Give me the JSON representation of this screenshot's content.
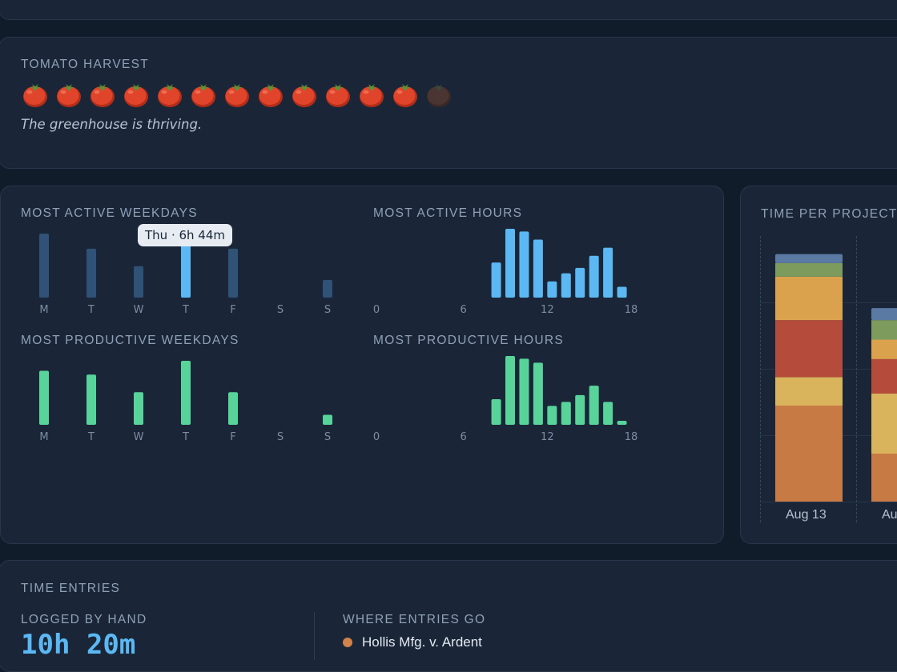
{
  "harvest": {
    "title": "TOMATO HARVEST",
    "total": 13,
    "ripe": 12,
    "tagline": "The greenhouse is thriving."
  },
  "activity": {
    "tooltip": "Thu · 6h 44m",
    "colors": {
      "weekday_dim": "#2f5276",
      "weekday_active": "#5bb8f2",
      "hours": "#5bb8f2",
      "productive": "#58d49a"
    },
    "weekdays": {
      "title": "MOST ACTIVE WEEKDAYS",
      "chart_data": {
        "type": "bar",
        "categories": [
          "M",
          "T",
          "W",
          "T",
          "F",
          "S",
          "S"
        ],
        "values": [
          5.1,
          3.9,
          2.5,
          4.2,
          3.9,
          0,
          1.4
        ],
        "highlight_index": 3
      }
    },
    "hours": {
      "title": "MOST ACTIVE HOURS",
      "chart_data": {
        "type": "bar",
        "x": [
          8,
          9,
          10,
          11,
          12,
          13,
          14,
          15,
          16,
          17
        ],
        "values": [
          2.6,
          5.1,
          4.9,
          4.3,
          1.2,
          1.8,
          2.2,
          3.1,
          3.7,
          0.8
        ],
        "xticks": [
          "0",
          "6",
          "12",
          "18"
        ],
        "xlim": [
          0,
          18
        ]
      }
    },
    "productive_weekdays": {
      "title": "MOST PRODUCTIVE WEEKDAYS",
      "chart_data": {
        "type": "bar",
        "categories": [
          "M",
          "T",
          "W",
          "T",
          "F",
          "S",
          "S"
        ],
        "values": [
          4.3,
          4.0,
          2.6,
          5.1,
          2.6,
          0,
          0.8
        ]
      }
    },
    "productive_hours": {
      "title": "MOST PRODUCTIVE HOURS",
      "chart_data": {
        "type": "bar",
        "x": [
          8,
          9,
          10,
          11,
          12,
          13,
          14,
          15,
          16,
          17
        ],
        "values": [
          1.9,
          5.1,
          4.9,
          4.6,
          1.4,
          1.7,
          2.2,
          2.9,
          1.7,
          0.3
        ],
        "xticks": [
          "0",
          "6",
          "12",
          "18"
        ],
        "xlim": [
          0,
          18
        ]
      }
    }
  },
  "projects": {
    "title": "TIME PER PROJECT",
    "chart_data": {
      "type": "bar",
      "categories": [
        "Aug 13",
        "Au"
      ],
      "stack_colors": [
        "#c87a45",
        "#d9b45c",
        "#b54b3a",
        "#dba24e",
        "#7e9b5e",
        "#5b7aa3"
      ],
      "stacks": [
        [
          6.4,
          1.9,
          3.8,
          2.9,
          0.9,
          0.6
        ],
        [
          3.2,
          4.0,
          2.3,
          1.3,
          1.3,
          0.8
        ]
      ],
      "ylim": [
        0,
        17
      ]
    }
  },
  "entries": {
    "title": "TIME ENTRIES",
    "logged_label": "LOGGED BY HAND",
    "logged_value": "10h 20m",
    "where_label": "WHERE ENTRIES GO",
    "destinations": [
      {
        "name": "Hollis Mfg. v. Ardent",
        "color": "#d2834a"
      }
    ]
  }
}
